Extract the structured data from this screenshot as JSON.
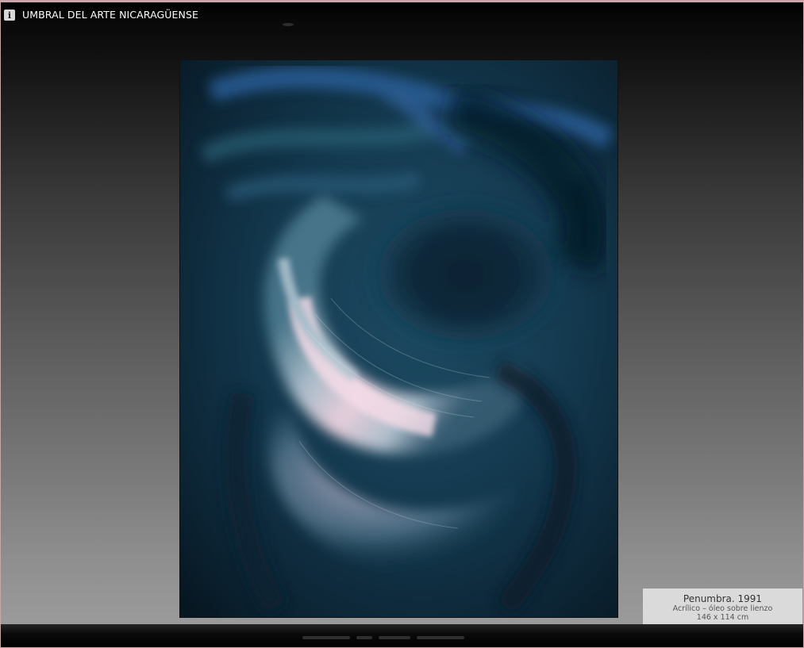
{
  "window": {
    "title": "UMBRAL DEL ARTE NICARAGÜENSE",
    "info_icon": "i",
    "accent_border": "#c9a5a8"
  },
  "artwork": {
    "title": "Penumbra. 1991",
    "medium": "Acrílico – óleo sobre lienzo",
    "dimensions": "146 x 114 cm"
  },
  "colors": {
    "painting_base": "#0e2a3a",
    "painting_glow": "#f2d6e3",
    "card_bg": "#dadada"
  }
}
